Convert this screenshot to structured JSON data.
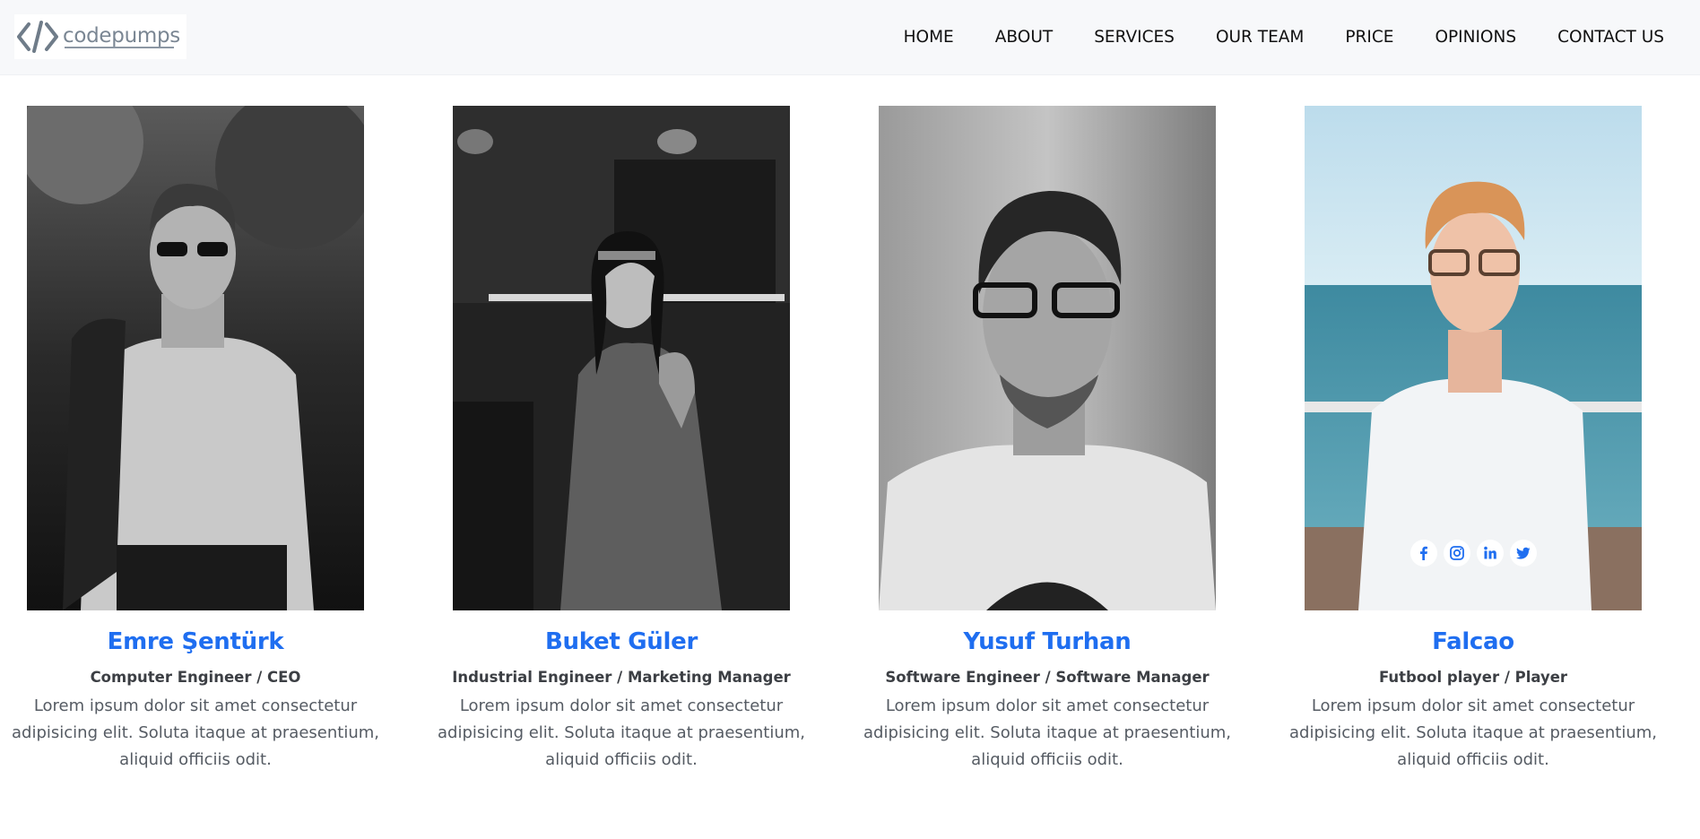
{
  "brand": {
    "logo_text": "codepumps"
  },
  "nav": {
    "items": [
      "HOME",
      "ABOUT",
      "SERVICES",
      "OUR TEAM",
      "PRICE",
      "OPINIONS",
      "CONTACT US"
    ]
  },
  "team": [
    {
      "name": "Emre Şentürk",
      "role": "Computer Engineer / CEO",
      "bio": "Lorem ipsum dolor sit amet consectetur adipisicing elit. Soluta itaque at praesentium, aliquid officiis odit."
    },
    {
      "name": "Buket Güler",
      "role": "Industrial Engineer / Marketing Manager",
      "bio": "Lorem ipsum dolor sit amet consectetur adipisicing elit. Soluta itaque at praesentium, aliquid officiis odit."
    },
    {
      "name": "Yusuf Turhan",
      "role": "Software Engineer / Software Manager",
      "bio": "Lorem ipsum dolor sit amet consectetur adipisicing elit. Soluta itaque at praesentium, aliquid officiis odit."
    },
    {
      "name": "Falcao",
      "role": "Futbool player / Player",
      "bio": "Lorem ipsum dolor sit amet consectetur adipisicing elit. Soluta itaque at praesentium, aliquid officiis odit."
    }
  ],
  "social_icons": [
    "facebook-icon",
    "instagram-icon",
    "linkedin-icon",
    "twitter-icon"
  ],
  "colors": {
    "name_blue": "#1f6ef0",
    "nav_bg": "#f7f8fa",
    "social_icon": "#1f6ef0"
  }
}
